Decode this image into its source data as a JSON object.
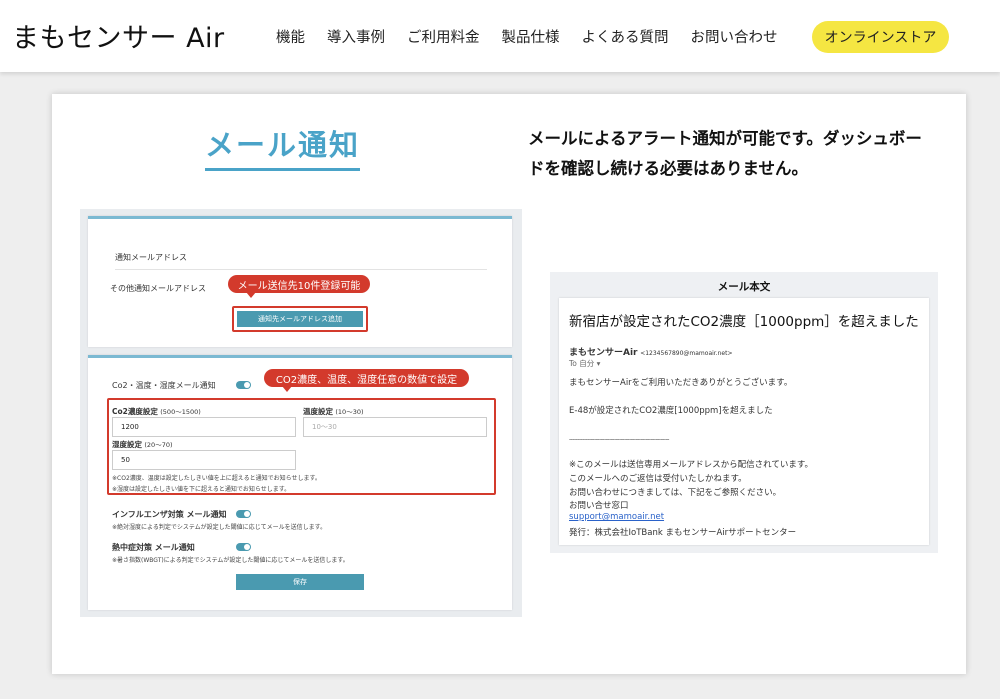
{
  "header": {
    "logo": "まもセンサー Air",
    "nav": [
      "機能",
      "導入事例",
      "ご利用料金",
      "製品仕様",
      "よくある質問",
      "お問い合わせ"
    ],
    "store_button": "オンラインストア"
  },
  "section": {
    "title": "メール通知",
    "description": "メールによるアラート通知が可能です。ダッシュボードを確認し続ける必要はありません。"
  },
  "settings": {
    "notify_heading": "通知メールアドレス",
    "other_label": "その他通知メールアドレス",
    "callout1": "メール送信先10件登録可能",
    "add_button": "通知先メールアドレス追加",
    "co2_mail_label": "Co2・温度・湿度メール通知",
    "callout2": "CO2濃度、温度、湿度任意の数値で設定",
    "co2_setting_label": "Co2濃度設定",
    "co2_range": "(500〜1500)",
    "co2_value": "1200",
    "temp_setting_label": "温度設定",
    "temp_range": "(10〜30)",
    "temp_placeholder": "10〜30",
    "humidity_setting_label": "湿度設定",
    "humidity_range": "(20〜70)",
    "humidity_value": "50",
    "note1": "※CO2濃度、温度は設定したしきい値を上に超えると通知でお知らせします。",
    "note2": "※湿度は設定したしきい値を下に超えると通知でお知らせします。",
    "influenza_label": "インフルエンザ対策 メール通知",
    "influenza_note": "※絶対湿度による判定でシステムが設定した閾値に応じてメールを送信します。",
    "heatstroke_label": "熱中症対策 メール通知",
    "heatstroke_note": "※暑さ指数(WBGT)による判定でシステムが設定した閾値に応じてメールを送信します。",
    "save_button": "保存"
  },
  "mail": {
    "heading": "メール本文",
    "subject": "新宿店が設定されたCO2濃度［1000ppm］を超えました",
    "sender_name": "まもセンサーAir",
    "sender_address": "<1234567890@mamoair.net>",
    "to_line": "To 自分 ▾",
    "greeting": "まもセンサーAirをご利用いただきありがとうございます。",
    "alert_line": "E-48が設定されたCO2濃度[1000ppm]を超えました",
    "separator": "------------------------------------------------------------",
    "footer1": "※このメールは送信専用メールアドレスから配信されています。",
    "footer2": "このメールへのご返信は受付いたしかねます。",
    "footer3": "お問い合わせにつきましては、下記をご参照ください。",
    "footer4": "お問い合せ窓口",
    "support_email": "support@mamoair.net",
    "footer5": "発行：株式会社IoTBank まもセンサーAirサポートセンター"
  }
}
